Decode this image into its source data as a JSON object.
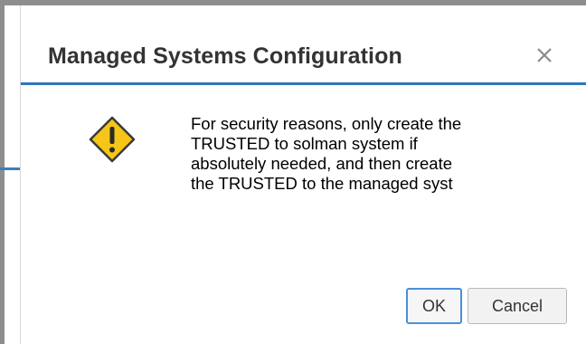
{
  "dialog": {
    "title": "Managed Systems Configuration",
    "close_icon": "close-icon",
    "warning_icon": "warning-icon",
    "message": "For security reasons, only create the\nTRUSTED to solman system if\nabsolutely needed, and then create\nthe TRUSTED to the managed syst",
    "ok_label": "OK",
    "cancel_label": "Cancel"
  },
  "colors": {
    "accent": "#2f76b8",
    "warning_fill": "#f5c518",
    "frame": "#8e8e8e"
  }
}
